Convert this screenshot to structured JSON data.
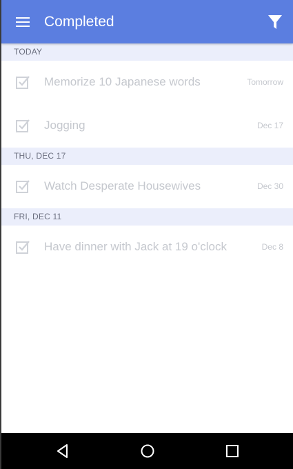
{
  "app_bar": {
    "title": "Completed",
    "menu_icon": "hamburger-menu-icon",
    "filter_icon": "filter-icon",
    "background": "#5b7ee0"
  },
  "sections": [
    {
      "header": "TODAY",
      "tasks": [
        {
          "title": "Memorize 10 Japanese words",
          "date": "Tomorrow",
          "checked": true
        },
        {
          "title": "Jogging",
          "date": "Dec 17",
          "checked": true
        }
      ]
    },
    {
      "header": "THU, DEC 17",
      "tasks": [
        {
          "title": "Watch Desperate Housewives",
          "date": "Dec 30",
          "checked": true
        }
      ]
    },
    {
      "header": "FRI, DEC 11",
      "tasks": [
        {
          "title": "Have dinner with Jack at 19 o'clock",
          "date": "Dec 8",
          "checked": true
        }
      ]
    }
  ],
  "nav_bar": {
    "back_icon": "back-triangle-icon",
    "home_icon": "home-circle-icon",
    "recents_icon": "recents-square-icon"
  },
  "colors": {
    "section_header_bg": "#ebeefb",
    "completed_text": "#c5c8ce",
    "nav_bg": "#000000"
  }
}
